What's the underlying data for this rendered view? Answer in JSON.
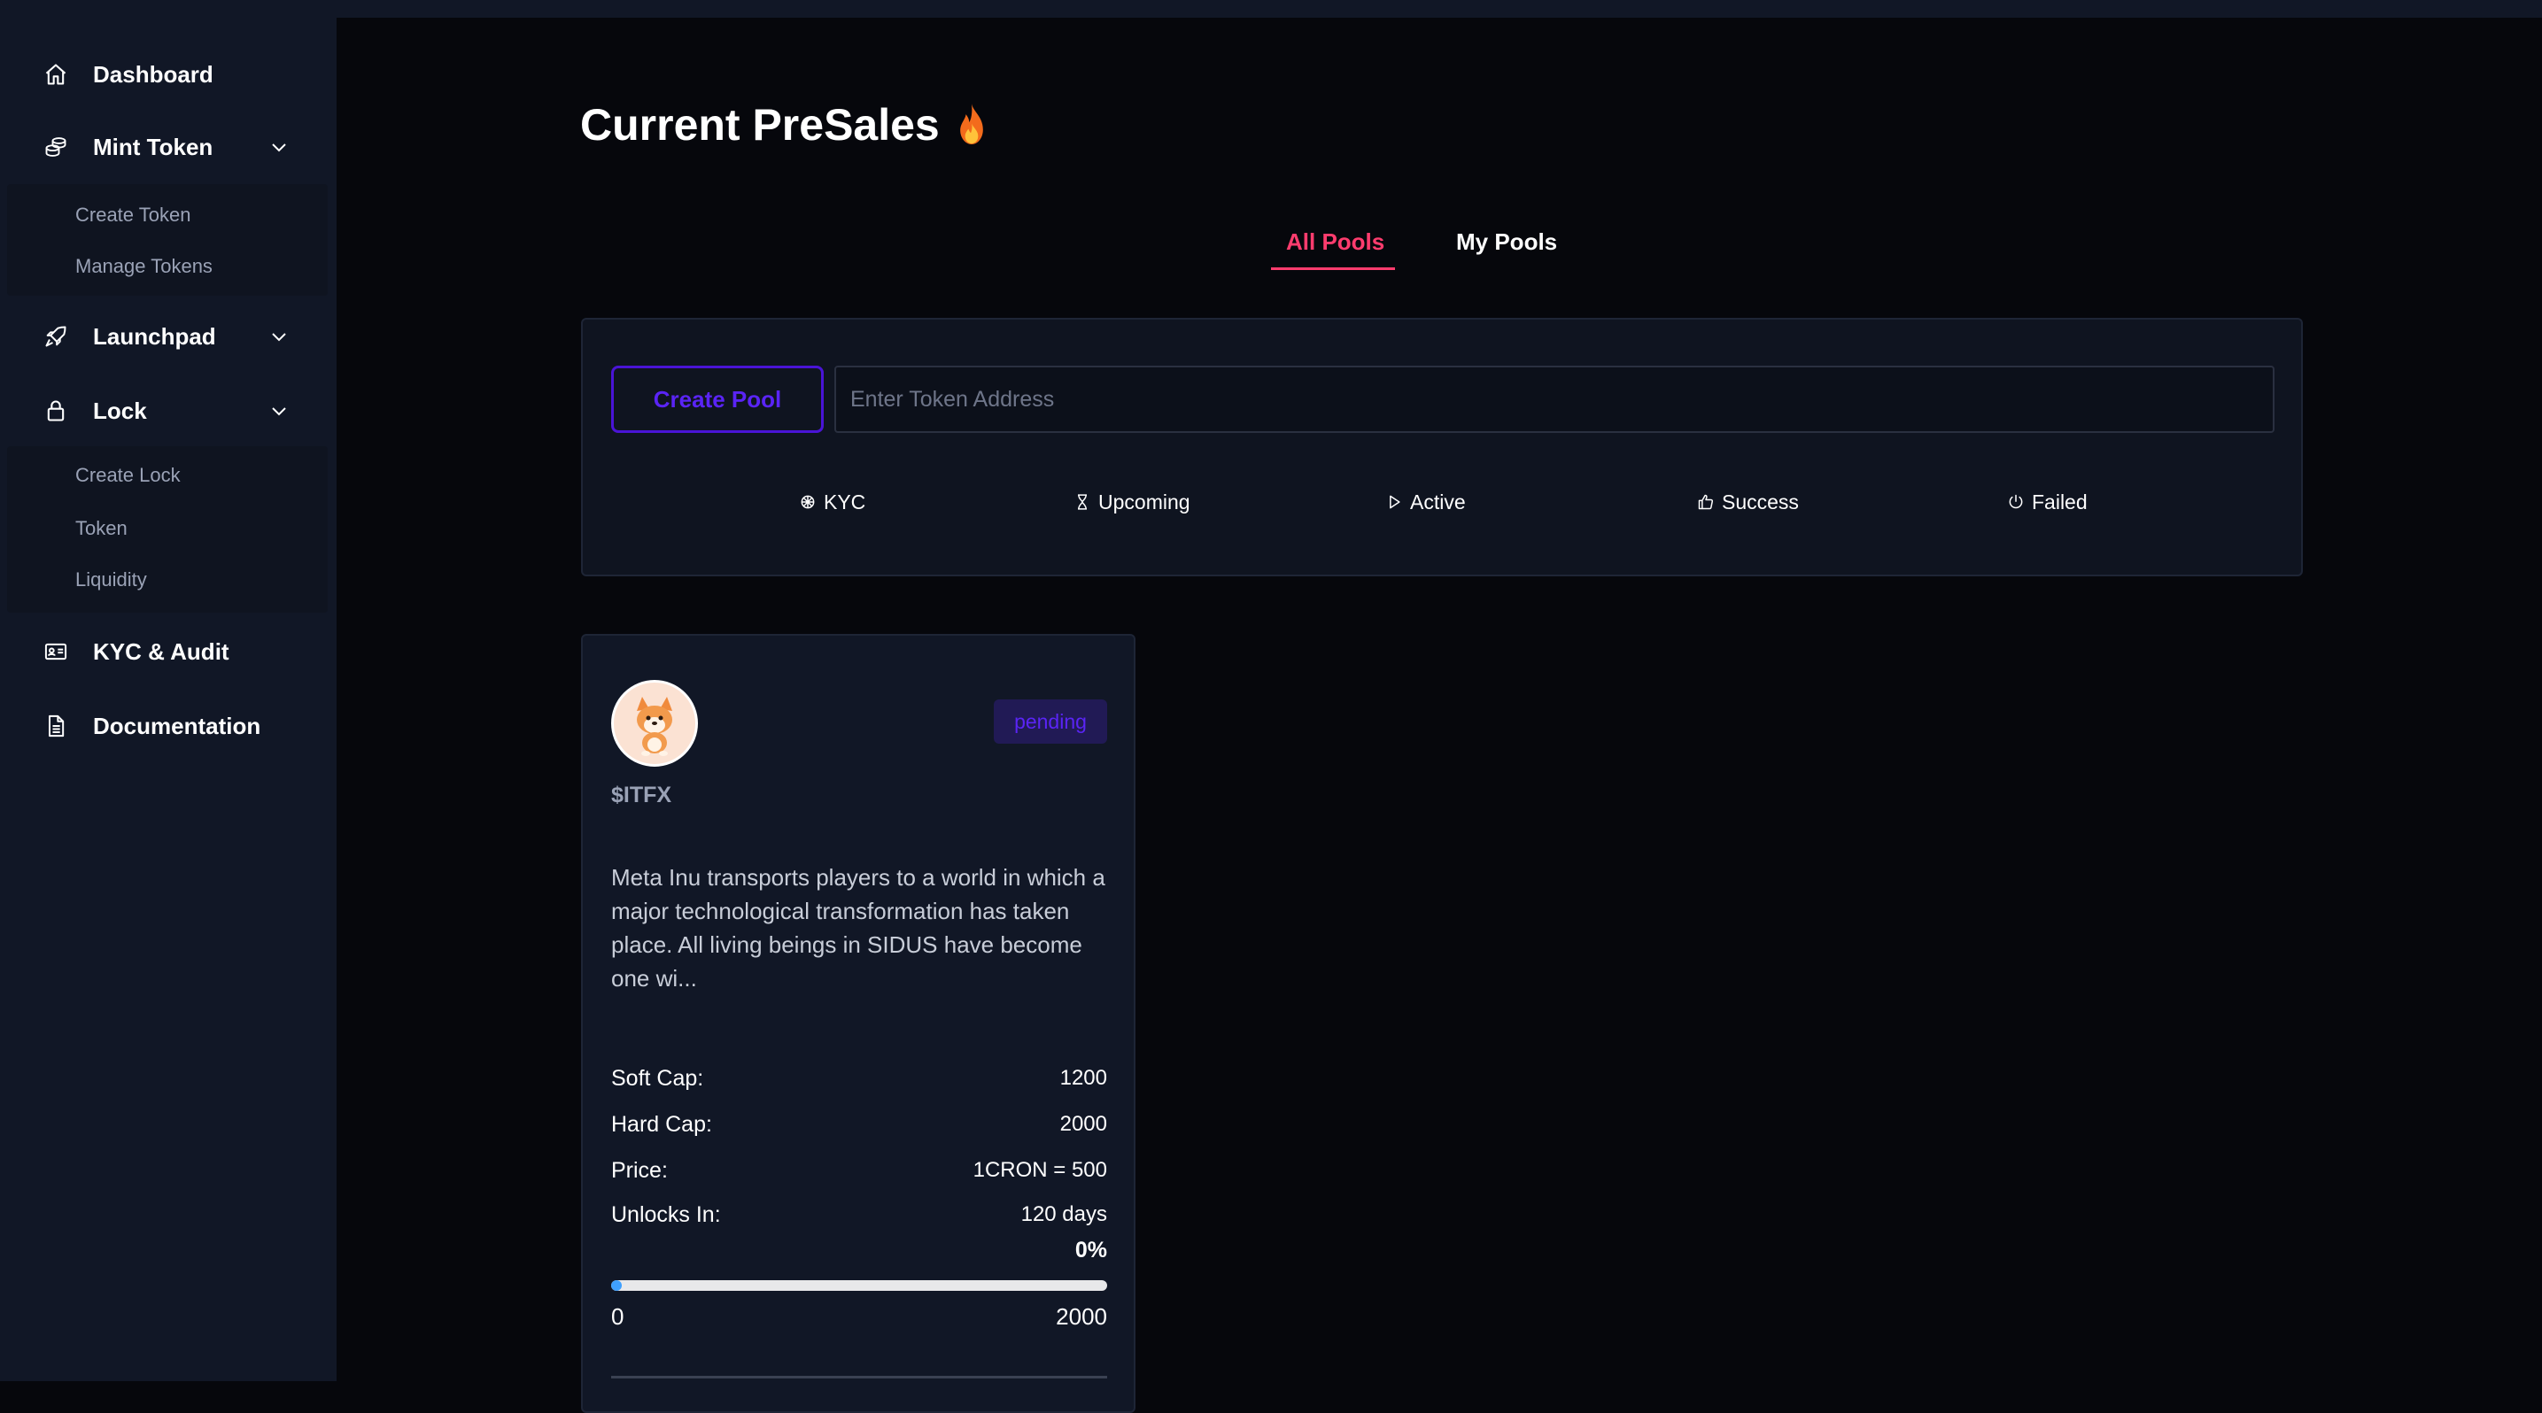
{
  "sidebar": {
    "items": [
      {
        "label": "Dashboard",
        "icon": "home-icon"
      },
      {
        "label": "Mint Token",
        "icon": "coins-icon",
        "expanded": true,
        "children": [
          "Create Token",
          "Manage Tokens"
        ]
      },
      {
        "label": "Launchpad",
        "icon": "rocket-icon",
        "expanded": false
      },
      {
        "label": "Lock",
        "icon": "lock-icon",
        "expanded": true,
        "children": [
          "Create Lock",
          "Token",
          "Liquidity"
        ]
      },
      {
        "label": "KYC & Audit",
        "icon": "id-card-icon"
      },
      {
        "label": "Documentation",
        "icon": "document-icon"
      }
    ]
  },
  "main": {
    "title": "Current PreSales",
    "tabs": [
      {
        "label": "All Pools",
        "active": true
      },
      {
        "label": "My Pools",
        "active": false
      }
    ],
    "create_pool_label": "Create Pool",
    "token_input": {
      "placeholder": "Enter Token Address",
      "value": ""
    },
    "filters": [
      {
        "label": "KYC",
        "icon": "badge-icon"
      },
      {
        "label": "Upcoming",
        "icon": "hourglass-icon"
      },
      {
        "label": "Active",
        "icon": "play-icon"
      },
      {
        "label": "Success",
        "icon": "thumbs-up-icon"
      },
      {
        "label": "Failed",
        "icon": "power-icon"
      }
    ]
  },
  "pool_card": {
    "status": "pending",
    "symbol": "$ITFX",
    "description": "Meta Inu transports players to a world in which a major technological transformation has taken place. All living beings in SIDUS have become one wi...",
    "stats": [
      {
        "label": "Soft Cap:",
        "value": "1200"
      },
      {
        "label": "Hard Cap:",
        "value": "2000"
      },
      {
        "label": "Price:",
        "value": "1CRON = 500"
      },
      {
        "label": "Unlocks In:",
        "value": "120 days"
      }
    ],
    "progress_label": "0%",
    "progress_fraction": 0,
    "progress_min": "0",
    "progress_max": "2000"
  },
  "colors": {
    "accent_pink": "#ff3c6e",
    "accent_purple": "#5a24f5",
    "sidebar_bg": "#111726",
    "page_bg": "#06070c",
    "progress_fill": "#3fa0ff"
  }
}
